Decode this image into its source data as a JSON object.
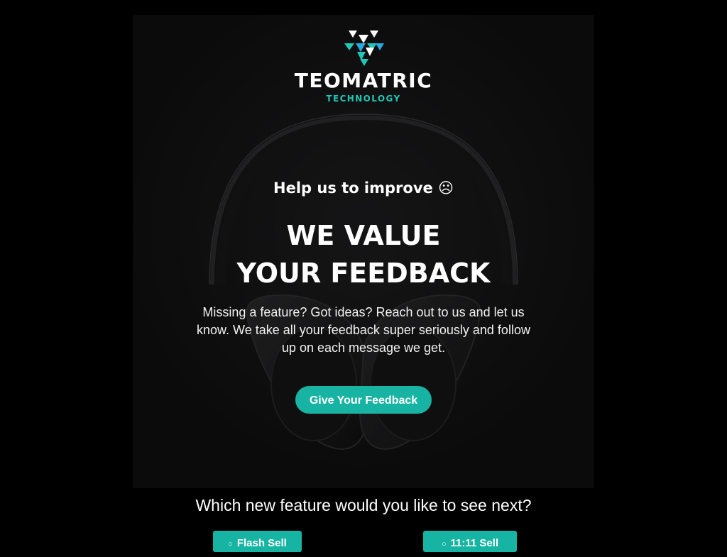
{
  "brand": {
    "name": "TEOMATRIC",
    "subtitle": "TECHNOLOGY",
    "primary_color": "#1fc7b7"
  },
  "hero": {
    "eyebrow": "Help us to improve ☹",
    "headline_line1": "WE VALUE",
    "headline_line2": "YOUR FEEDBACK",
    "description": "Missing a feature? Got ideas? Reach out to us and let us know. We take all your feedback super seriously and follow up on each message we get.",
    "cta_label": "Give Your Feedback",
    "cta_color": "#18b4a3"
  },
  "survey": {
    "question": "Which new feature would you like to see next?",
    "options": [
      {
        "label": "Flash Sell"
      },
      {
        "label": "11:11 Sell"
      }
    ]
  }
}
